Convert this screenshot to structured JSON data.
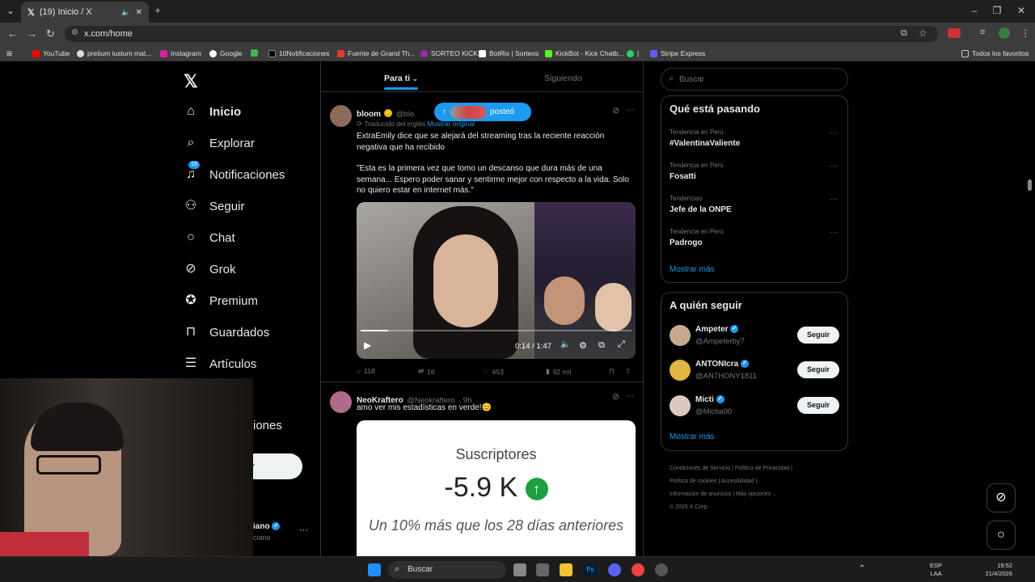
{
  "browser": {
    "tab_title": "(19) Inicio / X",
    "url": "x.com/home",
    "bookmarks": [
      "YouTube",
      "pretium iustum mat...",
      "Instagram",
      "Google",
      "10Notificaciones",
      "Fuente de Grand Th...",
      "SORTEO KICK",
      "BotRix | Sorteos",
      "KickBot - Kick Chatb...",
      "Stripe Express"
    ],
    "all_bookmarks": "Todos los favoritos"
  },
  "sidebar": {
    "items": [
      {
        "label": "Inicio",
        "icon": "home-icon"
      },
      {
        "label": "Explorar",
        "icon": "search-icon"
      },
      {
        "label": "Notificaciones",
        "icon": "bell-icon",
        "badge": "19"
      },
      {
        "label": "Seguir",
        "icon": "follow-icon"
      },
      {
        "label": "Chat",
        "icon": "chat-icon"
      },
      {
        "label": "Grok",
        "icon": "grok-icon"
      },
      {
        "label": "Premium",
        "icon": "premium-icon"
      },
      {
        "label": "Guardados",
        "icon": "bookmark-icon"
      },
      {
        "label": "Artículos",
        "icon": "articles-icon"
      }
    ],
    "partial_label": "iones",
    "partial_button": "r",
    "partial_user": "iano",
    "partial_handle": "ciano"
  },
  "feed": {
    "tabs": [
      "Para ti",
      "Siguiendo"
    ],
    "new_posts_pill": "posteó",
    "post1": {
      "name": "bloom",
      "handle": "@blo",
      "translated": "Traducido del inglés",
      "show_original": "Mostrar original",
      "text1": "ExtraEmily dice que se alejará del streaming tras la reciente reacción negativa que ha recibido",
      "text2": "\"Esta es la primera vez que tomo un descanso que dura más de una semana... Espero poder sanar y sentirme mejor con respecto a la vida. Solo no quiero estar en internet más.\"",
      "video_time": "0:14 / 1:47",
      "replies": "118",
      "reposts": "16",
      "likes": "453",
      "views": "92 mil"
    },
    "post2": {
      "name": "NeoKraftero",
      "handle": "@Neokraftero",
      "time": "· 9h",
      "text": "amo ver mis estadísticas en verde!😊",
      "card_title": "Suscriptores",
      "card_value": "-5.9 K",
      "card_sub": "Un 10% más que los 28 días anteriores"
    }
  },
  "right": {
    "search_placeholder": "Buscar",
    "trends_title": "Qué está pasando",
    "trends": [
      {
        "category": "Tendencia en Perú",
        "name": "#ValentinaValiente"
      },
      {
        "category": "Tendencia en Perú",
        "name": "Fosatti"
      },
      {
        "category": "Tendencias",
        "name": "Jefe de la ONPE"
      },
      {
        "category": "Tendencia en Perú",
        "name": "Padrogo"
      }
    ],
    "show_more": "Mostrar más",
    "who_title": "A quién seguir",
    "follow": [
      {
        "name": "Ampeter",
        "handle": "@Ampeterby7"
      },
      {
        "name": "ANTONIcra",
        "handle": "@AN7HONY1811"
      },
      {
        "name": "Micti",
        "handle": "@Mictia00"
      }
    ],
    "follow_label": "Seguir",
    "footer": [
      "Condiciones de Servicio",
      "Política de Privacidad",
      "Política de cookies",
      "Accesibilidad",
      "Información de anuncios",
      "Más opciones ...",
      "© 2026 X Corp."
    ]
  },
  "taskbar": {
    "search": "Buscar",
    "lang1": "ESP",
    "lang2": "LAA",
    "time": "19:52",
    "date": "21/4/2026"
  },
  "colors": {
    "accent": "#1d9bf0",
    "green": "#1e9e3e"
  }
}
